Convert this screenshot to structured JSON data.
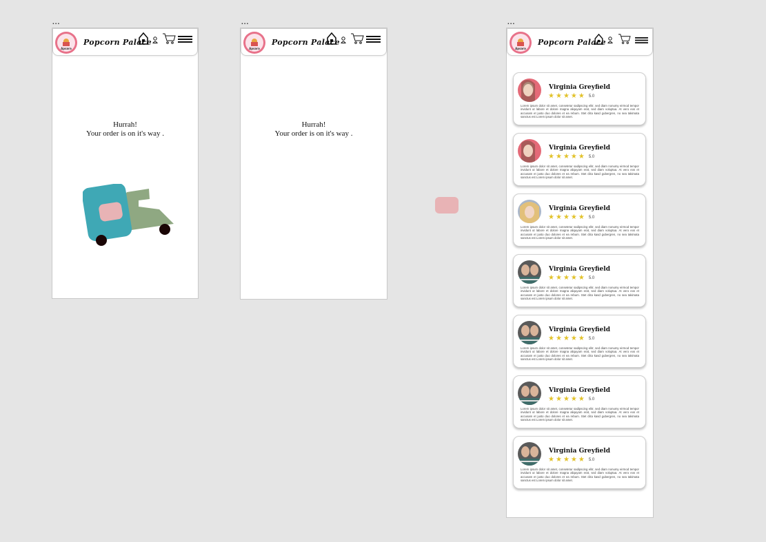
{
  "frames": [
    {
      "label": "...",
      "brand": "Popcorn Palace",
      "logo_text": "Apsara",
      "message_line1": "Hurrah!",
      "message_line2": "Your order is on it's way ."
    },
    {
      "label": "...",
      "brand": "Popcorn Palace",
      "logo_text": "Apsara",
      "message_line1": "Hurrah!",
      "message_line2": "Your order is on it's way ."
    },
    {
      "label": "...",
      "brand": "Popcorn Palace",
      "logo_text": "Apsara"
    }
  ],
  "reviews": [
    {
      "name": "Virginia Greyfield",
      "score": "5.0",
      "text": "Lorem ipsum dolor sit amet, consetetur sadipscing elitr, sed diam nonumy eirmod tempor invidunt ut labore et dolore magna aliquyam erat, sed diam voluptua. At vero eos et accusam et justo duo dolores et ea rebum. Stet clita kasd gubergren, no sea takimata sanctus est Lorem ipsum dolor sit amet."
    },
    {
      "name": "Virginia Greyfield",
      "score": "5.0",
      "text": "Lorem ipsum dolor sit amet, consetetur sadipscing elitr, sed diam nonumy eirmod tempor invidunt ut labore et dolore magna aliquyam erat, sed diam voluptua. At vero eos et accusam et justo duo dolores et ea rebum. Stet clita kasd gubergren, no sea takimata sanctus est Lorem ipsum dolor sit amet."
    },
    {
      "name": "Virginia Greyfield",
      "score": "5.0",
      "text": "Lorem ipsum dolor sit amet, consetetur sadipscing elitr, sed diam nonumy eirmod tempor invidunt ut labore et dolore magna aliquyam erat, sed diam voluptua. At vero eos et accusam et justo duo dolores et ea rebum. Stet clita kasd gubergren, no sea takimata sanctus est Lorem ipsum dolor sit amet."
    },
    {
      "name": "Virginia Greyfield",
      "score": "5.0",
      "text": "Lorem ipsum dolor sit amet, consetetur sadipscing elitr, sed diam nonumy eirmod tempor invidunt ut labore et dolore magna aliquyam erat, sed diam voluptua. At vero eos et accusam et justo duo dolores et ea rebum. Stet clita kasd gubergren, no sea takimata sanctus est Lorem ipsum dolor sit amet."
    },
    {
      "name": "Virginia Greyfield",
      "score": "5.0",
      "text": "Lorem ipsum dolor sit amet, consetetur sadipscing elitr, sed diam nonumy eirmod tempor invidunt ut labore et dolore magna aliquyam erat, sed diam voluptua. At vero eos et accusam et justo duo dolores et ea rebum. Stet clita kasd gubergren, no sea takimata sanctus est Lorem ipsum dolor sit amet."
    },
    {
      "name": "Virginia Greyfield",
      "score": "5.0",
      "text": "Lorem ipsum dolor sit amet, consetetur sadipscing elitr, sed diam nonumy eirmod tempor invidunt ut labore et dolore magna aliquyam erat, sed diam voluptua. At vero eos et accusam et justo duo dolores et ea rebum. Stet clita kasd gubergren, no sea takimata sanctus est Lorem ipsum dolor sit amet."
    },
    {
      "name": "Virginia Greyfield",
      "score": "5.0",
      "text": "Lorem ipsum dolor sit amet, consetetur sadipscing elitr, sed diam nonumy eirmod tempor invidunt ut labore et dolore magna aliquyam erat, sed diam voluptua. At vero eos et accusam et justo duo dolores et ea rebum. Stet clita kasd gubergren, no sea takimata sanctus est Lorem ipsum dolor sit amet."
    }
  ],
  "icons": {
    "home": "home-icon",
    "user": "user-icon",
    "cart": "cart-icon",
    "menu": "hamburger-menu-icon",
    "truck": "delivery-truck-illustration"
  },
  "colors": {
    "logo_pink": "#e8728a",
    "truck_teal": "#3fa8b5",
    "truck_green": "#8fa882",
    "truck_window": "#e8b3b5",
    "star": "#e2c22a"
  }
}
